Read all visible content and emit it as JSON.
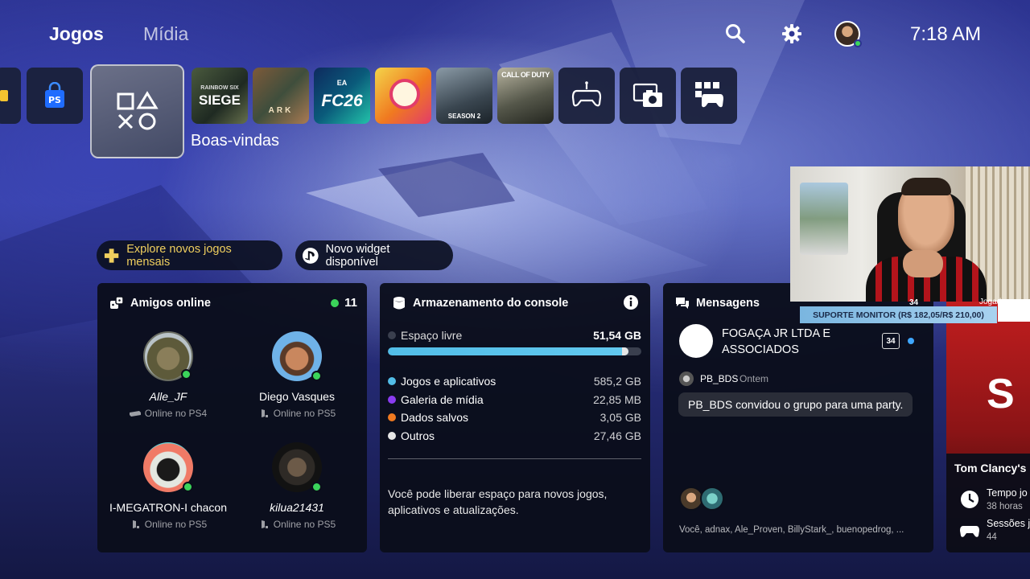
{
  "header": {
    "tabs": [
      {
        "label": "Jogos",
        "active": true
      },
      {
        "label": "Mídia",
        "active": false
      }
    ],
    "icons": [
      "search-icon",
      "gear-icon"
    ],
    "time": "7:18 AM"
  },
  "game_row": {
    "selected_label": "Boas-vindas",
    "tiles": [
      {
        "name": "edge-tile"
      },
      {
        "name": "playstation-store",
        "icon": "store-bag-icon"
      },
      {
        "name": "boas-vindas",
        "icon": "playstation-shapes-icon"
      },
      {
        "name": "rainbow-six-siege",
        "text": "SIEGE",
        "subtext": "RAINBOW SIX"
      },
      {
        "name": "ark",
        "text": "ARK"
      },
      {
        "name": "ea-sports-fc26",
        "text": "FC26",
        "subtext": "EA"
      },
      {
        "name": "colorful-game"
      },
      {
        "name": "black-ops",
        "text": "SEASON 2"
      },
      {
        "name": "call-of-duty",
        "text": "CALL OF DUTY"
      },
      {
        "name": "controller-tile",
        "icon": "controller-icon"
      },
      {
        "name": "media-gallery-tile",
        "icon": "media-camera-icon"
      },
      {
        "name": "game-library-tile",
        "icon": "game-library-icon"
      }
    ]
  },
  "chips": {
    "plus": "Explore novos jogos mensais",
    "widget": "Novo widget disponível"
  },
  "friends": {
    "title": "Amigos online",
    "count": "11",
    "list": [
      {
        "name": "Alle_JF",
        "status": "Online no PS4"
      },
      {
        "name": "Diego Vasques",
        "status": "Online no PS5"
      },
      {
        "name": "I-MEGATRON-I chacon",
        "status": "Online no PS5"
      },
      {
        "name": "kilua21431",
        "status": "Online no PS5"
      }
    ]
  },
  "storage": {
    "title": "Armazenamento do console",
    "free_label": "Espaço livre",
    "free_value": "51,54 GB",
    "used_fraction": 0.95,
    "rows": [
      {
        "label": "Jogos e aplicativos",
        "value": "585,2 GB",
        "color": "#52bde7"
      },
      {
        "label": "Galeria de mídia",
        "value": "22,85 MB",
        "color": "#8a3cf0"
      },
      {
        "label": "Dados salvos",
        "value": "3,05 GB",
        "color": "#f07a20"
      },
      {
        "label": "Outros",
        "value": "27,46 GB",
        "color": "#e6e6e6"
      }
    ],
    "note": "Você pode liberar espaço para novos jogos, aplicativos e atualizações."
  },
  "messages": {
    "title": "Mensagens",
    "group_name": "FOGAÇA JR LTDA E ASSOCIADOS",
    "badge": "34",
    "sender": "PB_BDS",
    "time": "Ontem",
    "text": "PB_BDS convidou o grupo para uma party.",
    "members": "Você, adnax, Ale_Proven, BillyStark_, buenopedrog, ..."
  },
  "game_card": {
    "logo": "S",
    "title": "Tom Clancy's R",
    "playtime_label": "Tempo jo",
    "playtime_value": "38 horas",
    "sessions_label": "Sessões jo",
    "sessions_value": "44"
  },
  "stream_overlay": {
    "banner": "SUPORTE MONITOR (R$ 182,05/R$ 210,00)",
    "peek_badge": "34",
    "peek_text": "Jogados r"
  },
  "colors": {
    "online": "#3bd45a",
    "accent_blue": "#52bde7",
    "plus_gold": "#f0cf5e"
  }
}
